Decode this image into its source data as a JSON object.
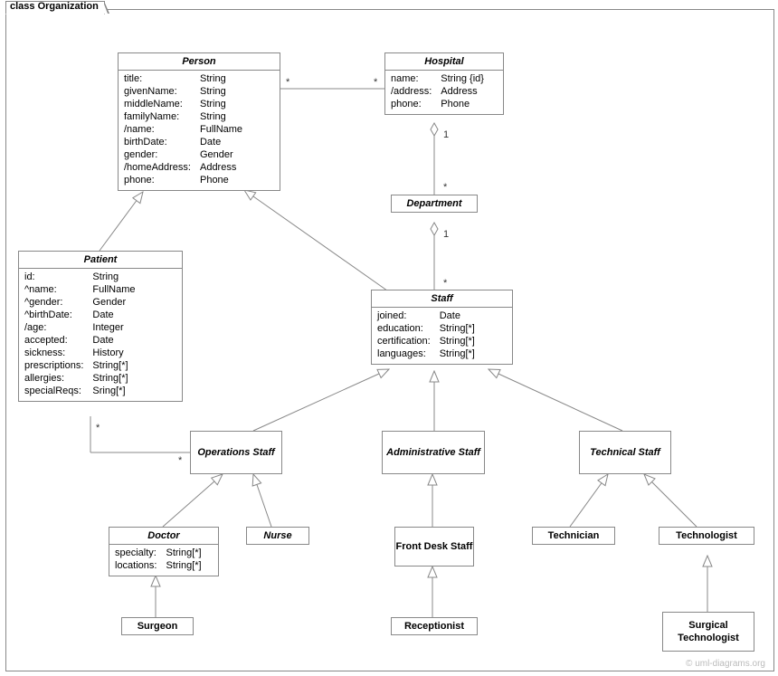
{
  "frame": {
    "label": "class Organization"
  },
  "watermark": "© uml-diagrams.org",
  "classes": {
    "person": {
      "title": "Person",
      "attrs": [
        [
          "title:",
          "String"
        ],
        [
          "givenName:",
          "String"
        ],
        [
          "middleName:",
          "String"
        ],
        [
          "familyName:",
          "String"
        ],
        [
          "/name:",
          "FullName"
        ],
        [
          "birthDate:",
          "Date"
        ],
        [
          "gender:",
          "Gender"
        ],
        [
          "/homeAddress:",
          "Address"
        ],
        [
          "phone:",
          "Phone"
        ]
      ]
    },
    "hospital": {
      "title": "Hospital",
      "attrs": [
        [
          "name:",
          "String {id}"
        ],
        [
          "/address:",
          "Address"
        ],
        [
          "phone:",
          "Phone"
        ]
      ]
    },
    "department": {
      "title": "Department"
    },
    "patient": {
      "title": "Patient",
      "attrs": [
        [
          "id:",
          "String"
        ],
        [
          "^name:",
          "FullName"
        ],
        [
          "^gender:",
          "Gender"
        ],
        [
          "^birthDate:",
          "Date"
        ],
        [
          "/age:",
          "Integer"
        ],
        [
          "accepted:",
          "Date"
        ],
        [
          "sickness:",
          "History"
        ],
        [
          "prescriptions:",
          "String[*]"
        ],
        [
          "allergies:",
          "String[*]"
        ],
        [
          "specialReqs:",
          "Sring[*]"
        ]
      ]
    },
    "staff": {
      "title": "Staff",
      "attrs": [
        [
          "joined:",
          "Date"
        ],
        [
          "education:",
          "String[*]"
        ],
        [
          "certification:",
          "String[*]"
        ],
        [
          "languages:",
          "String[*]"
        ]
      ]
    },
    "opsStaff": {
      "title": "Operations Staff"
    },
    "adminStaff": {
      "title": "Administrative Staff"
    },
    "techStaff": {
      "title": "Technical Staff"
    },
    "doctor": {
      "title": "Doctor",
      "attrs": [
        [
          "specialty:",
          "String[*]"
        ],
        [
          "locations:",
          "String[*]"
        ]
      ]
    },
    "nurse": {
      "title": "Nurse"
    },
    "frontDesk": {
      "title": "Front Desk Staff"
    },
    "receptionist": {
      "title": "Receptionist"
    },
    "technician": {
      "title": "Technician"
    },
    "technologist": {
      "title": "Technologist"
    },
    "surgTech": {
      "title": "Surgical Technologist"
    },
    "surgeon": {
      "title": "Surgeon"
    }
  },
  "multiplicities": {
    "person_hospital_l": "*",
    "person_hospital_r": "*",
    "hospital_dept_top": "1",
    "hospital_dept_bot": "*",
    "dept_staff_top": "1",
    "dept_staff_bot": "*",
    "patient_ops_l": "*",
    "patient_ops_r": "*"
  }
}
